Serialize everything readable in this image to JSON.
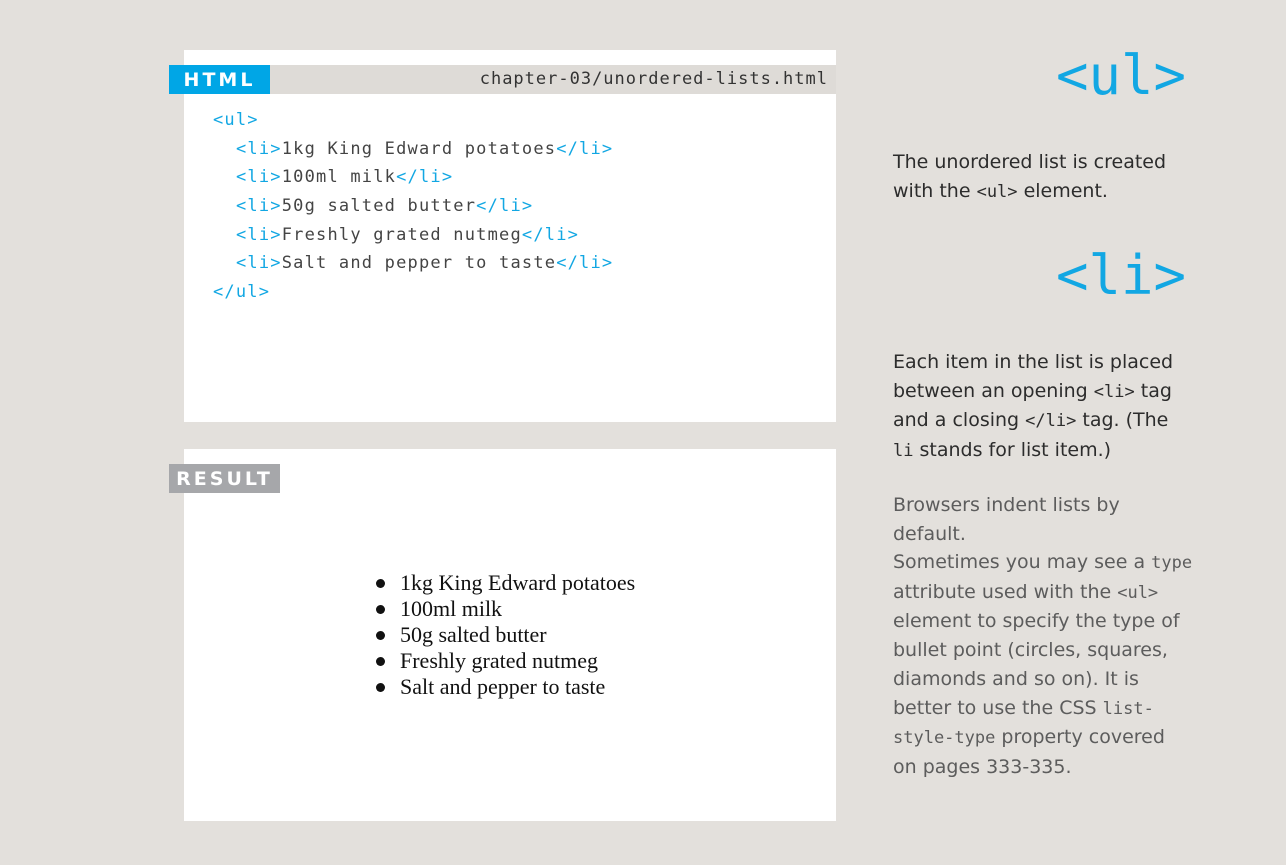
{
  "code_panel": {
    "tab_label": "HTML",
    "file_path": "chapter-03/unordered-lists.html",
    "lines": [
      {
        "open": "<ul>"
      },
      {
        "open": "<li>",
        "text": "1kg King Edward potatoes",
        "close": "</li>"
      },
      {
        "open": "<li>",
        "text": "100ml milk",
        "close": "</li>"
      },
      {
        "open": "<li>",
        "text": "50g salted butter",
        "close": "</li>"
      },
      {
        "open": "<li>",
        "text": "Freshly grated nutmeg",
        "close": "</li>"
      },
      {
        "open": "<li>",
        "text": "Salt and pepper to taste",
        "close": "</li>"
      },
      {
        "close": "</ul>"
      }
    ]
  },
  "result_panel": {
    "tab_label": "RESULT",
    "items": [
      "1kg King Edward potatoes",
      "100ml milk",
      "50g salted butter",
      "Freshly grated nutmeg",
      "Salt and pepper to taste"
    ]
  },
  "sidebar": {
    "ul_heading": "<ul>",
    "ul_description": {
      "part1": "The unordered list is created with the ",
      "code1": "<ul>",
      "part2": " element."
    },
    "li_heading": "<li>",
    "li_description": {
      "part1": "Each item in the list is placed between an opening ",
      "code1": "<li>",
      "part2": " tag and a closing ",
      "code2": "</li>",
      "part3": " tag. (The ",
      "code3": "li",
      "part4": " stands for list item.)"
    },
    "indent_note": "Browsers indent lists by default.",
    "type_note": {
      "part1": "Sometimes you may see a ",
      "code1": "type",
      "part2": " attribute used with the ",
      "code2": "<ul>",
      "part3": " element to specify the type of bullet point (circles, squares, diamonds and so on). It is better to use the CSS ",
      "code3": "list-style-type",
      "part4": " property covered on pages 333-335."
    },
    "colors": {
      "accent": "#00a6e6",
      "result_tab": "#a6a7aa",
      "background": "#e3e0dc"
    }
  }
}
